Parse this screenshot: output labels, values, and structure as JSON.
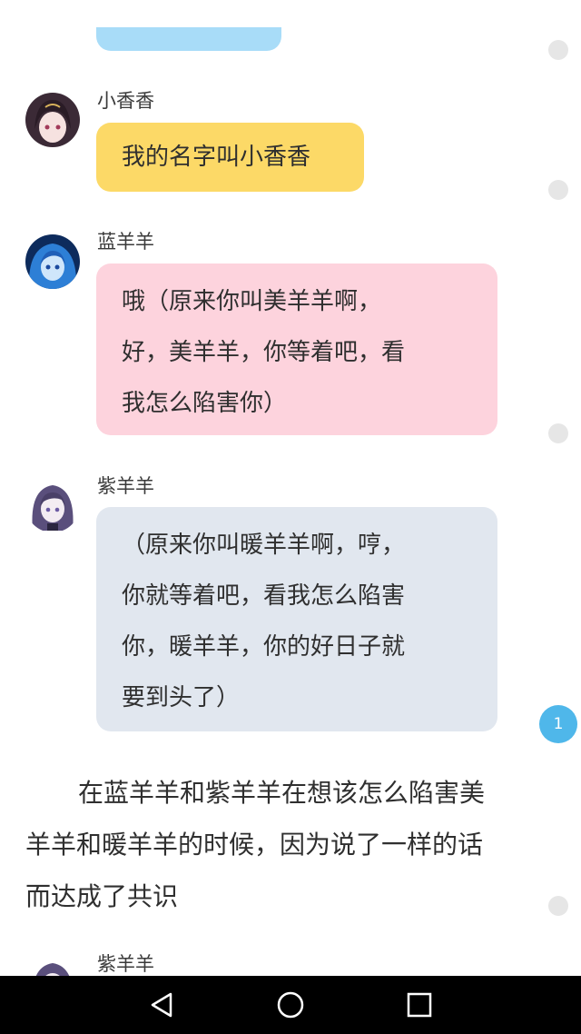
{
  "top_bubble": {
    "color": "#a8dcf8"
  },
  "messages": [
    {
      "sender": "小香香",
      "avatar": "dark-hair-girl-avatar",
      "bubble_color": "#fcd967",
      "lines": [
        "我的名字叫小香香"
      ]
    },
    {
      "sender": "蓝羊羊",
      "avatar": "blue-hair-girl-avatar",
      "bubble_color": "#fdd3dd",
      "lines": [
        "哦（原来你叫美羊羊啊，",
        "好，美羊羊，你等着吧，看",
        "我怎么陷害你）"
      ]
    },
    {
      "sender": "紫羊羊",
      "avatar": "purple-hair-girl-avatar",
      "bubble_color": "#e1e7ef",
      "lines": [
        "（原来你叫暖羊羊啊，哼，",
        "你就等着吧，看我怎么陷害",
        "你，暖羊羊，你的好日子就",
        "要到头了）"
      ]
    },
    {
      "sender": "紫羊羊",
      "avatar": "purple-hair-girl-avatar"
    }
  ],
  "narration": {
    "lines": [
      "在蓝羊羊和紫羊羊在想该怎么陷害美",
      "羊羊和暖羊羊的时候，因为说了一样的话",
      "而达成了共识"
    ]
  },
  "comment_badge": {
    "count": "1",
    "color": "#4fb7ea"
  },
  "navbar": {
    "back": "back-triangle-icon",
    "home": "home-circle-icon",
    "recents": "recents-square-icon"
  }
}
